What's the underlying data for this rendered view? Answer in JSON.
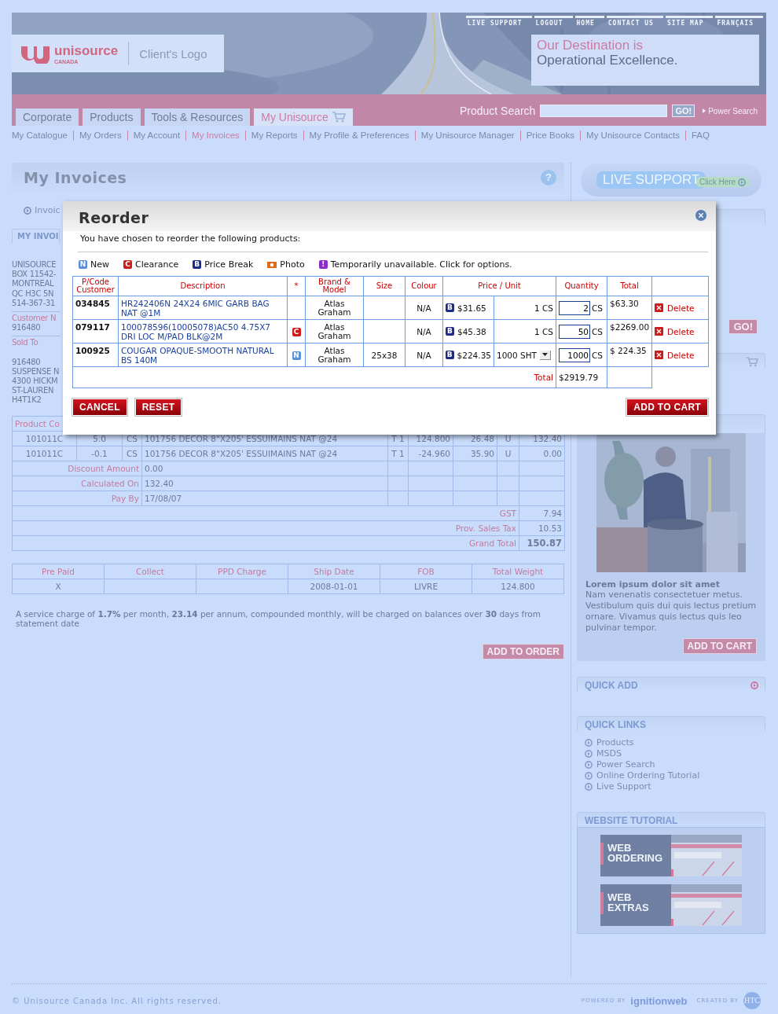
{
  "header": {
    "top_links": [
      "LIVE SUPPORT",
      "LOGOUT",
      "HOME",
      "CONTACT US",
      "SITE MAP",
      "FRANÇAIS"
    ],
    "logo": {
      "name": "unisource",
      "sub": "CANADA"
    },
    "client_logo": "Client's Logo",
    "tagline": [
      "Our Destination is",
      "Operational Excellence."
    ]
  },
  "nav": {
    "tabs": [
      {
        "label": "Corporate",
        "kind": "plain",
        "selected": false
      },
      {
        "label": "Products",
        "kind": "plain",
        "selected": false
      },
      {
        "label": "Tools & Resources",
        "kind": "plain",
        "selected": false
      },
      {
        "label": "My Unisource",
        "kind": "cart",
        "selected": true
      }
    ],
    "search": {
      "label": "Product Search",
      "button": "GO!",
      "link": "Power Search"
    }
  },
  "subnav": [
    {
      "label": "My Catalogue",
      "selected": false
    },
    {
      "label": "My Orders",
      "selected": false
    },
    {
      "label": "My Account",
      "selected": false
    },
    {
      "label": "My Invoices",
      "selected": true
    },
    {
      "label": "My Reports",
      "selected": false
    },
    {
      "label": "My Profile & Preferences",
      "selected": false
    },
    {
      "label": "My Unisource Manager",
      "selected": false
    },
    {
      "label": "Price Books",
      "selected": false
    },
    {
      "label": "My Unisource Contacts",
      "selected": false
    },
    {
      "label": "FAQ",
      "selected": false
    }
  ],
  "main": {
    "title": "My Invoices",
    "help": "?",
    "breadcrumb": "Invoic",
    "tab": "MY INVOI",
    "address": [
      "UNISOURCE",
      "BOX 11542-",
      "MONTREAL",
      "QC H3C 5N",
      "514-367-31"
    ],
    "customer_label": "Customer N",
    "customer_value": "916480",
    "sold_to_label": "Sold To",
    "sold_to": [
      "916480",
      "SUSPENSE N",
      "4300 HICKM",
      "ST-LAUREN",
      "H4T1K2"
    ],
    "invoice_table": {
      "first_heading": "Product Co",
      "rows": [
        [
          "101011C",
          "5.0",
          "CS",
          "101756 DECOR 8\"X205' ESSUIMAINS NAT @24",
          "T 1",
          "124.800",
          "26.48",
          "U",
          "132.40"
        ],
        [
          "101011C",
          "-0.1",
          "CS",
          "101756 DECOR 8\"X205' ESSUIMAINS NAT @24",
          "T 1",
          "-24.960",
          "35.90",
          "U",
          "0.00"
        ]
      ],
      "summary": [
        {
          "label": "Discount Amount",
          "value": "0.00"
        },
        {
          "label": "Calculated On",
          "value": "132.40"
        },
        {
          "label": "Pay By",
          "value": "17/08/07"
        }
      ],
      "totals": [
        {
          "label": "GST",
          "value": "7.94",
          "kind": "line"
        },
        {
          "label": "Prov. Sales Tax",
          "value": "10.53",
          "kind": "line"
        },
        {
          "label": "Grand Total",
          "value": "150.87",
          "kind": "grand"
        }
      ]
    },
    "shipping_table": {
      "columns": [
        {
          "label": "Pre Paid",
          "value": "X"
        },
        {
          "label": "Collect"
        },
        {
          "label": "PPD Charge"
        },
        {
          "label": "Ship Date",
          "value": "2008-01-01"
        },
        {
          "label": "FOB",
          "value": "LIVRE"
        },
        {
          "label": "Total Weight",
          "value": "124.800"
        }
      ]
    },
    "service_note": "A service charge of **1.7%** per month, **23.14** per annum, compounded monthly, will be charged on balances over **30** days from statement date",
    "add_to_order": "ADD TO ORDER"
  },
  "sidebar": {
    "live_support": {
      "label": "LIVE SUPPORT",
      "action": "Click Here"
    },
    "go_button": "GO!",
    "featured": {
      "title": "Lorem ipsum dolor sit amet",
      "text": "Nam venenatis consectetuer metus. Vestibulum quis dui quis lectus pretium ornare. Vivamus quis lectus quis leo pulvinar tempor.",
      "button": "ADD TO CART"
    },
    "quick_add": "QUICK ADD",
    "quick_links": {
      "title": "QUICK LINKS",
      "items": [
        "Products",
        "MSDS",
        "Power Search",
        "Online Ordering Tutorial",
        "Live Support"
      ]
    },
    "tutorial": {
      "title": "WEBSITE TUTORIAL",
      "banners": [
        "WEB ORDERING",
        "WEB EXTRAS"
      ]
    }
  },
  "footer": {
    "copyright": "© Unisource Canada Inc. All rights reserved.",
    "powered_label": "POWERED BY",
    "powered_brand": "ignitionweb",
    "created_label": "CREATED BY",
    "created_logo": "HTC"
  },
  "reorder": {
    "title": "Reorder",
    "intro": "You have chosen to reorder the following products:",
    "legend": [
      {
        "kind": "letter",
        "badge": "N",
        "color": "#5b8fd8",
        "label": "New"
      },
      {
        "kind": "letter",
        "badge": "C",
        "color": "#cc1b1b",
        "label": "Clearance"
      },
      {
        "kind": "letter",
        "badge": "B",
        "color": "#1c2a8a",
        "label": "Price Break"
      },
      {
        "kind": "camera",
        "color": "#e06a1a",
        "label": "Photo"
      },
      {
        "kind": "letter",
        "badge": "!",
        "color": "#8d2bc8",
        "label": "Temporarily unavailable. Click for options."
      }
    ],
    "columns": [
      "P/Code Customer",
      "Description",
      "*",
      "Brand & Model",
      "Size",
      "Colour",
      "Price / Unit",
      "Quantity",
      "Total"
    ],
    "rows": [
      {
        "code": "034845",
        "description": "HR242406N 24X24 6MIC GARB BAG NAT @1M",
        "brand": "Atlas Graham",
        "colour": "N/A",
        "price_badge": "B",
        "price": "$31.65",
        "unit": {
          "kind": "text",
          "value": "1 CS"
        },
        "quantity": "2",
        "quantity_unit": "CS",
        "total": "$63.30",
        "delete": "Delete"
      },
      {
        "code": "079117",
        "description": "100078596(10005078)AC50 4.75X7 DRI LOC M/PAD BLK@2M",
        "flag": {
          "badge": "C",
          "color": "#cc1b1b"
        },
        "brand": "Atlas Graham",
        "colour": "N/A",
        "price_badge": "B",
        "price": "$45.38",
        "unit": {
          "kind": "text",
          "value": "1 CS"
        },
        "quantity": "50",
        "quantity_unit": "CS",
        "total": "$2269.00",
        "delete": "Delete"
      },
      {
        "code": "100925",
        "description": "COUGAR OPAQUE-SMOOTH NATURAL BS 140M",
        "flag": {
          "badge": "N",
          "color": "#5b8fd8"
        },
        "brand": "Atlas Graham",
        "size": "25x38",
        "colour": "N/A",
        "price_badge": "B",
        "price": "$224.35",
        "unit": {
          "kind": "select",
          "value": "1000 SHT"
        },
        "quantity": "1000",
        "quantity_unit": "CS",
        "total": "$ 224.35",
        "delete": "Delete"
      }
    ],
    "total_label": "Total",
    "total": "$2919.79",
    "buttons": [
      "CANCEL",
      "RESET",
      "ADD TO CART"
    ]
  }
}
